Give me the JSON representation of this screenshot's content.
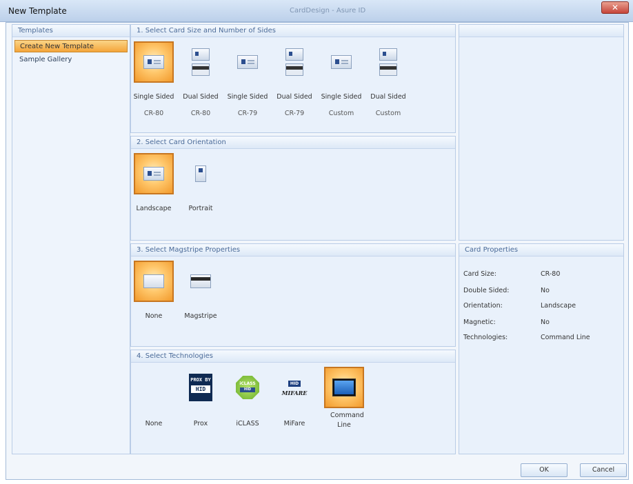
{
  "window": {
    "title": "New Template",
    "app_title": "CardDesign - Asure ID"
  },
  "templates_panel": {
    "header": "Templates",
    "items": [
      {
        "label": "Create New Template",
        "selected": true
      },
      {
        "label": "Sample Gallery",
        "selected": false
      }
    ]
  },
  "sections": {
    "size": {
      "header": "1. Select Card Size and Number of Sides",
      "options": [
        {
          "line1": "Single Sided",
          "line2": "CR-80",
          "icon": "single-card-icon",
          "selected": true
        },
        {
          "line1": "Dual Sided",
          "line2": "CR-80",
          "icon": "dual-card-icon",
          "selected": false
        },
        {
          "line1": "Single Sided",
          "line2": "CR-79",
          "icon": "single-card-icon",
          "selected": false
        },
        {
          "line1": "Dual Sided",
          "line2": "CR-79",
          "icon": "dual-card-icon",
          "selected": false
        },
        {
          "line1": "Single Sided",
          "line2": "Custom",
          "icon": "single-card-icon",
          "selected": false
        },
        {
          "line1": "Dual Sided",
          "line2": "Custom",
          "icon": "dual-card-icon",
          "selected": false
        }
      ]
    },
    "orientation": {
      "header": "2. Select Card Orientation",
      "options": [
        {
          "label": "Landscape",
          "icon": "landscape-card-icon",
          "selected": true
        },
        {
          "label": "Portrait",
          "icon": "portrait-card-icon",
          "selected": false
        }
      ]
    },
    "magstripe": {
      "header": "3. Select Magstripe Properties",
      "options": [
        {
          "label": "None",
          "icon": "plain-card-icon",
          "selected": true
        },
        {
          "label": "Magstripe",
          "icon": "magstripe-card-icon",
          "selected": false
        }
      ]
    },
    "technologies": {
      "header": "4. Select Technologies",
      "options": [
        {
          "label": "None",
          "icon": "none",
          "selected": false
        },
        {
          "label": "Prox",
          "icon": "prox-logo-icon",
          "logo_top": "PROX BY",
          "logo_bottom": "HID",
          "selected": false
        },
        {
          "label": "iCLASS",
          "icon": "iclass-logo-icon",
          "logo_top": "iCLASS",
          "logo_bottom": "HID",
          "selected": false
        },
        {
          "label": "MiFare",
          "icon": "mifare-logo-icon",
          "logo_top": "HID",
          "logo_bottom": "MIFARE",
          "selected": false
        },
        {
          "label": "Command Line",
          "icon": "command-line-icon",
          "selected": true
        }
      ]
    }
  },
  "card_properties": {
    "header": "Card Properties",
    "rows": [
      {
        "name": "Card Size:",
        "value": "CR-80"
      },
      {
        "name": "Double Sided:",
        "value": "No"
      },
      {
        "name": "Orientation:",
        "value": "Landscape"
      },
      {
        "name": "Magnetic:",
        "value": "No"
      },
      {
        "name": "Technologies:",
        "value": "Command Line"
      }
    ]
  },
  "buttons": {
    "ok": "OK",
    "cancel": "Cancel"
  },
  "colors": {
    "selection_orange": "#f4a43a",
    "panel_blue": "#e9f1fb",
    "header_text": "#4a6a98"
  }
}
